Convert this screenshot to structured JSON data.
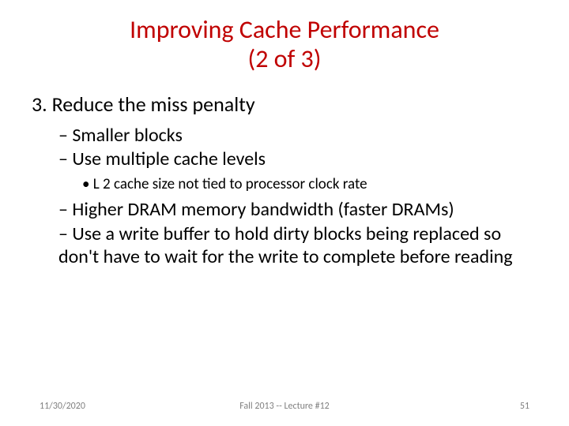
{
  "title_line1": "Improving Cache Performance",
  "title_line2": "(2 of 3)",
  "main_point": "3. Reduce the miss penalty",
  "bullets": {
    "b1": "Smaller blocks",
    "b2": "Use multiple cache levels",
    "b2a": "L 2 cache size not tied to processor clock rate",
    "b3": "Higher DRAM memory bandwidth (faster DRAMs)",
    "b4": "Use a write buffer to hold dirty blocks being replaced so don't have to wait for the write to complete before reading"
  },
  "footer": {
    "date": "11/30/2020",
    "center": "Fall 2013 -- Lecture #12",
    "page": "51"
  }
}
